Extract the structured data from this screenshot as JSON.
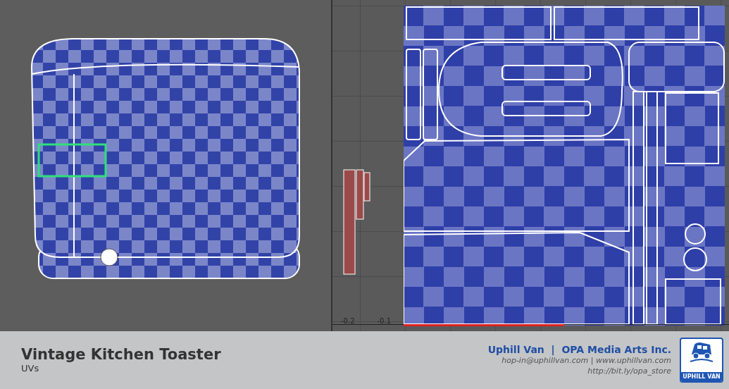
{
  "uv_editor": {
    "axis_labels": [
      "-0.2",
      "-0.1"
    ]
  },
  "footer": {
    "title": "Vintage Kitchen Toaster",
    "subtitle": "UVs",
    "credit": "Uphill Van  |  OPA Media Arts Inc.",
    "contact": "hop-in@uphillvan.com | www.uphillvan.com",
    "store": "http://bit.ly/opa_store",
    "logo_text": "UPHILL VAN"
  }
}
